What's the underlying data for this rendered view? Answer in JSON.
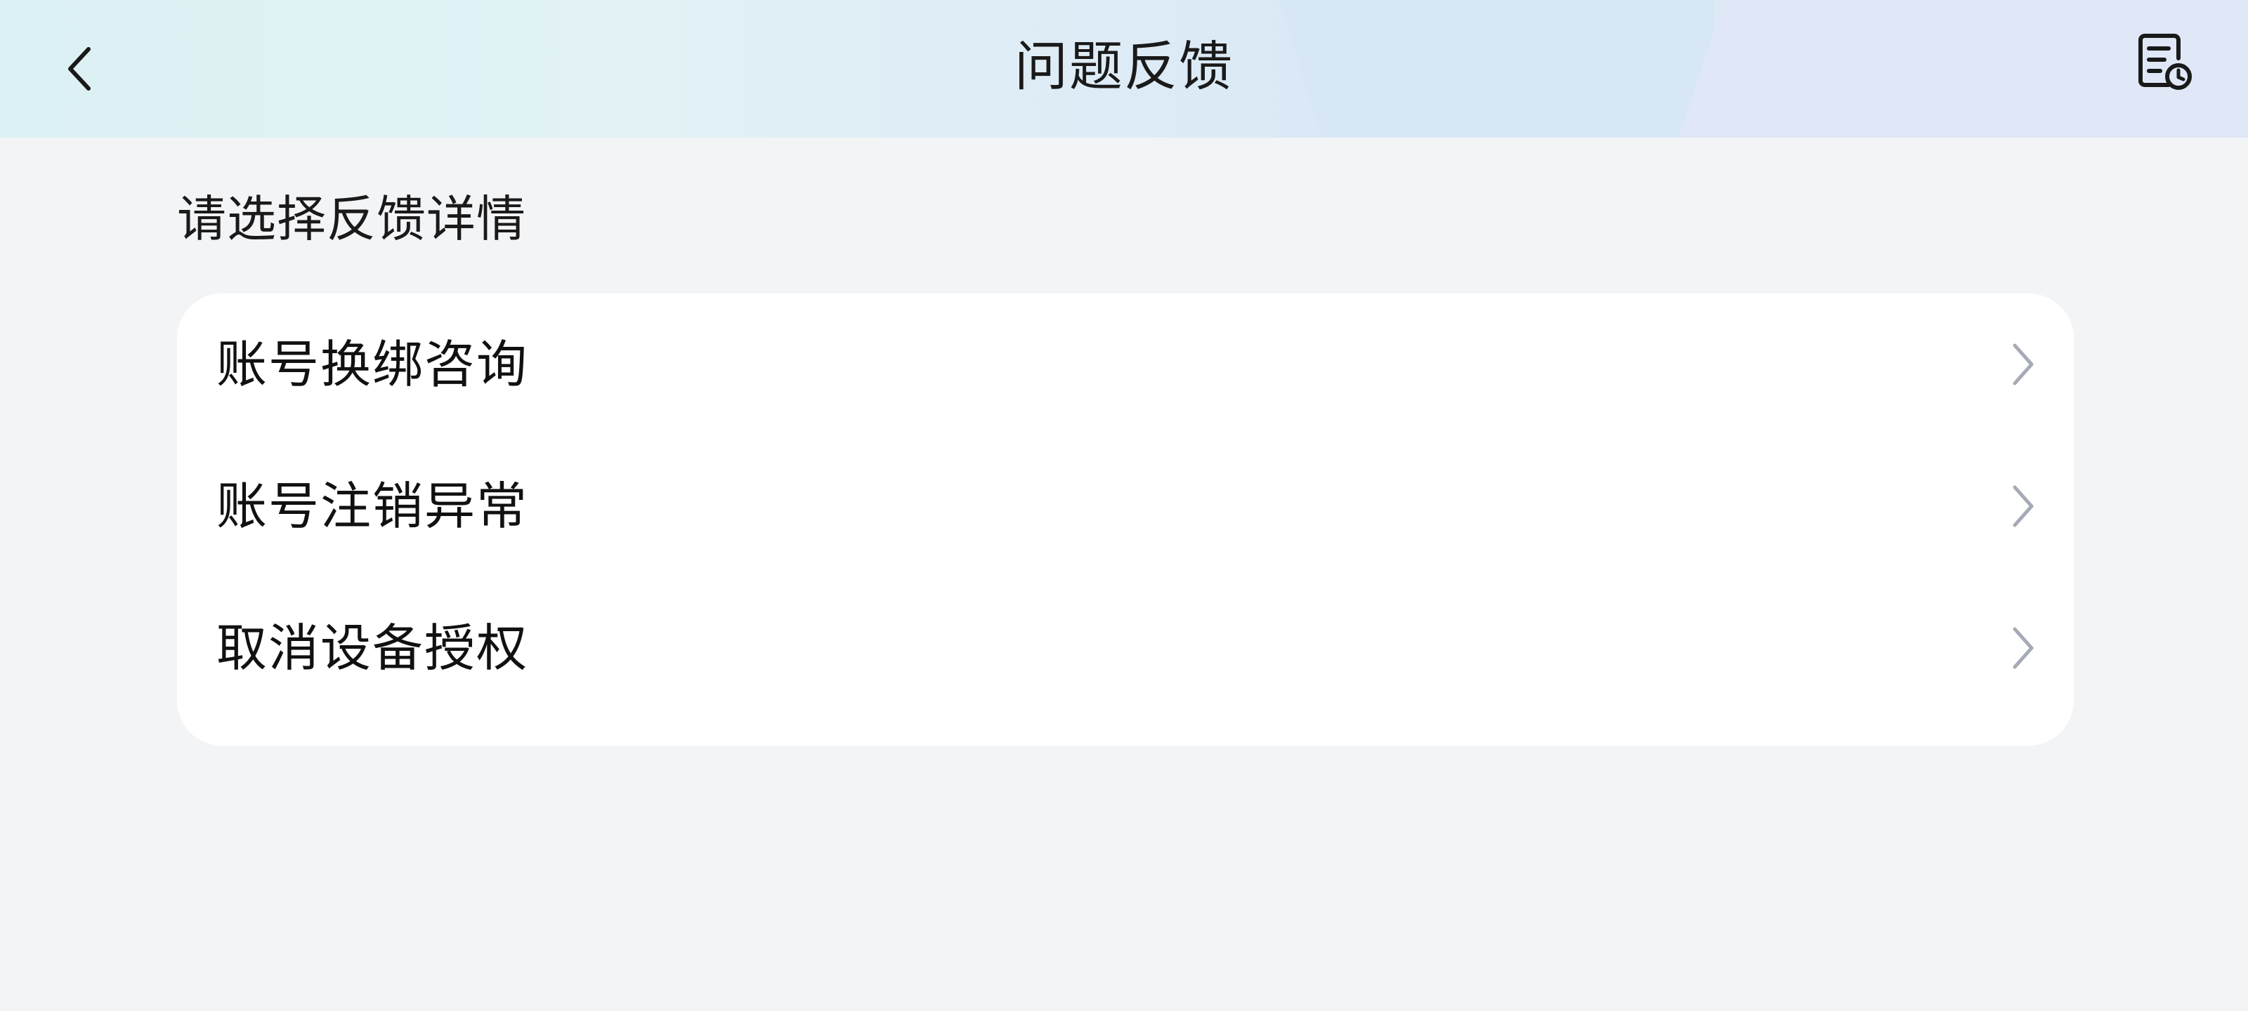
{
  "header": {
    "title": "问题反馈",
    "back_icon": "chevron-left-icon",
    "history_icon": "document-clock-icon"
  },
  "section": {
    "label": "请选择反馈详情"
  },
  "options": [
    {
      "label": "账号换绑咨询",
      "icon": "chevron-right-icon"
    },
    {
      "label": "账号注销异常",
      "icon": "chevron-right-icon"
    },
    {
      "label": "取消设备授权",
      "icon": "chevron-right-icon"
    }
  ],
  "colors": {
    "background": "#f3f4f6",
    "card": "#ffffff",
    "text": "#111111",
    "chevron": "#a6a9b6"
  }
}
